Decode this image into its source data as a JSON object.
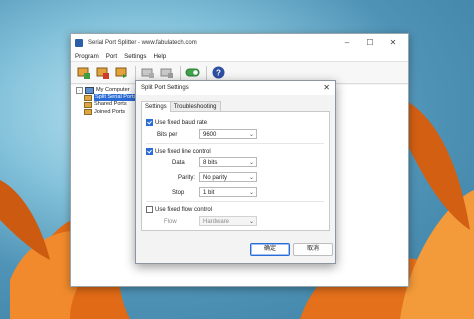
{
  "window": {
    "title": "Serial Port Splitter - www.fabulatech.com",
    "minimize": "–",
    "maximize": "☐",
    "close": "✕"
  },
  "menu": [
    "Program",
    "Port",
    "Settings",
    "Help"
  ],
  "tree": {
    "root": "My Computer",
    "items": [
      "Split Serial Ports",
      "Shared Ports",
      "Joined Ports"
    ]
  },
  "dialog": {
    "title": "Split Port Settings",
    "close": "✕",
    "tabs": [
      "Settings",
      "Troubleshooting"
    ],
    "baud": {
      "checkbox": "Use fixed baud rate",
      "checked": true,
      "label": "Bits per",
      "value": "9600"
    },
    "line": {
      "checkbox": "Use fixed line control",
      "checked": true,
      "data_label": "Data",
      "data_value": "8 bits",
      "parity_label": "Parity:",
      "parity_value": "No parity",
      "stop_label": "Stop",
      "stop_value": "1 bit"
    },
    "flow": {
      "checkbox": "Use fixed flow control",
      "checked": false,
      "label": "Flow",
      "value": "Hardware"
    },
    "ok": "确定",
    "cancel": "取消"
  },
  "colors": {
    "accent": "#2a6bd6",
    "flower": "#e8741c"
  }
}
